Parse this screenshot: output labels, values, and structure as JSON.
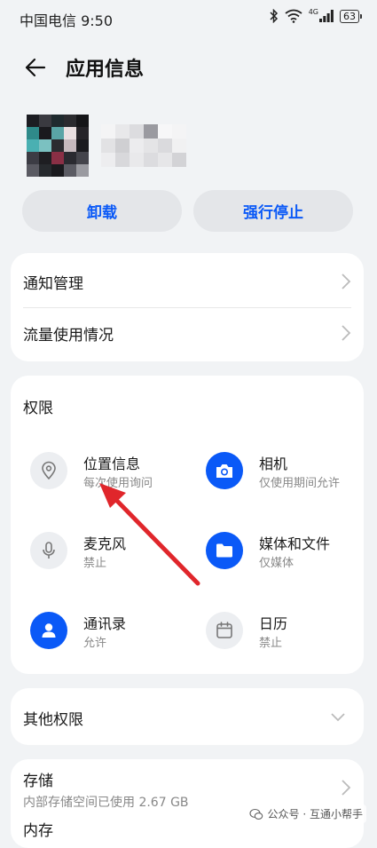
{
  "status_bar": {
    "carrier_time": "中国电信 9:50",
    "signal_text": "4G",
    "battery": "63"
  },
  "header": {
    "title": "应用信息"
  },
  "actions": {
    "uninstall": "卸载",
    "force_stop": "强行停止"
  },
  "settings_rows": [
    {
      "label": "通知管理"
    },
    {
      "label": "流量使用情况"
    }
  ],
  "permissions": {
    "title": "权限",
    "items": [
      {
        "name": "位置信息",
        "status": "每次使用询问",
        "icon": "location-icon"
      },
      {
        "name": "相机",
        "status": "仅使用期间允许",
        "icon": "camera-icon"
      },
      {
        "name": "麦克风",
        "status": "禁止",
        "icon": "microphone-icon"
      },
      {
        "name": "媒体和文件",
        "status": "仅媒体",
        "icon": "folder-icon"
      },
      {
        "name": "通讯录",
        "status": "允许",
        "icon": "contacts-icon"
      },
      {
        "name": "日历",
        "status": "禁止",
        "icon": "calendar-icon"
      }
    ]
  },
  "other_permissions": {
    "label": "其他权限"
  },
  "storage": {
    "label": "存储",
    "detail": "内部存储空间已使用 2.67 GB",
    "next_label": "内存"
  },
  "watermark": {
    "text": "公众号 · 互通小帮手"
  },
  "colors": {
    "accent": "#0a59f7",
    "annotation_arrow": "#e0262b"
  }
}
